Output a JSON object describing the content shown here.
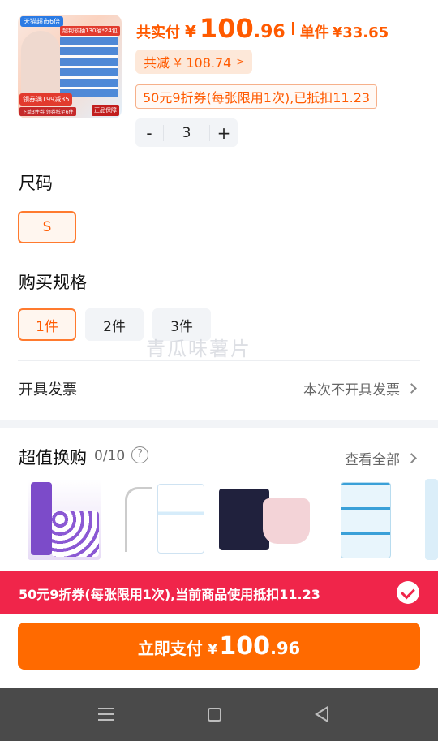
{
  "product": {
    "thumb": {
      "store_tag": "天猫超市6倍",
      "title_tag": "超韧软抽130抽*24包",
      "promo": "领券满199减35",
      "promo_sub": "下单3件券 领券抵至6件",
      "seal": "正品保障"
    },
    "price": {
      "total_label": "共实付",
      "currency": "¥",
      "total_integer": "100",
      "total_decimal": ".96",
      "unit_label": "单件",
      "unit_price": "¥33.65"
    },
    "saved": {
      "text": "共减 ¥ 108.74",
      "chevron": ">"
    },
    "coupon_tag": "50元9折券(每张限用1次),已抵扣11.23",
    "quantity": {
      "minus": "-",
      "value": "3",
      "plus": "+"
    }
  },
  "size": {
    "title": "尺码",
    "options": [
      {
        "label": "S",
        "selected": true
      }
    ]
  },
  "spec": {
    "title": "购买规格",
    "options": [
      {
        "label": "1件",
        "selected": true
      },
      {
        "label": "2件",
        "selected": false
      },
      {
        "label": "3件",
        "selected": false
      }
    ]
  },
  "watermark": "青瓜味薯片",
  "invoice": {
    "label": "开具发票",
    "value": "本次不开具发票"
  },
  "exchange": {
    "title": "超值换购",
    "count": "0/10",
    "help_icon": "?",
    "view_all": "查看全部",
    "items": [
      "toilet-paper",
      "floss-picks",
      "period-pants",
      "floss-box",
      "partial-item"
    ]
  },
  "coupon_bar": {
    "text": "50元9折券(每张限用1次),当前商品使用抵扣11.23",
    "checked": true
  },
  "pay": {
    "label": "立即支付",
    "currency": "¥",
    "integer": "100",
    "decimal": ".96"
  },
  "colors": {
    "accent": "#ff5a00",
    "pay_button": "#ff6a00",
    "coupon_bar": "#f0254a",
    "navbar": "#4a4a4a"
  },
  "icons": {
    "nav_menu": "menu-icon",
    "nav_home": "home-square-icon",
    "nav_back": "back-triangle-icon"
  }
}
